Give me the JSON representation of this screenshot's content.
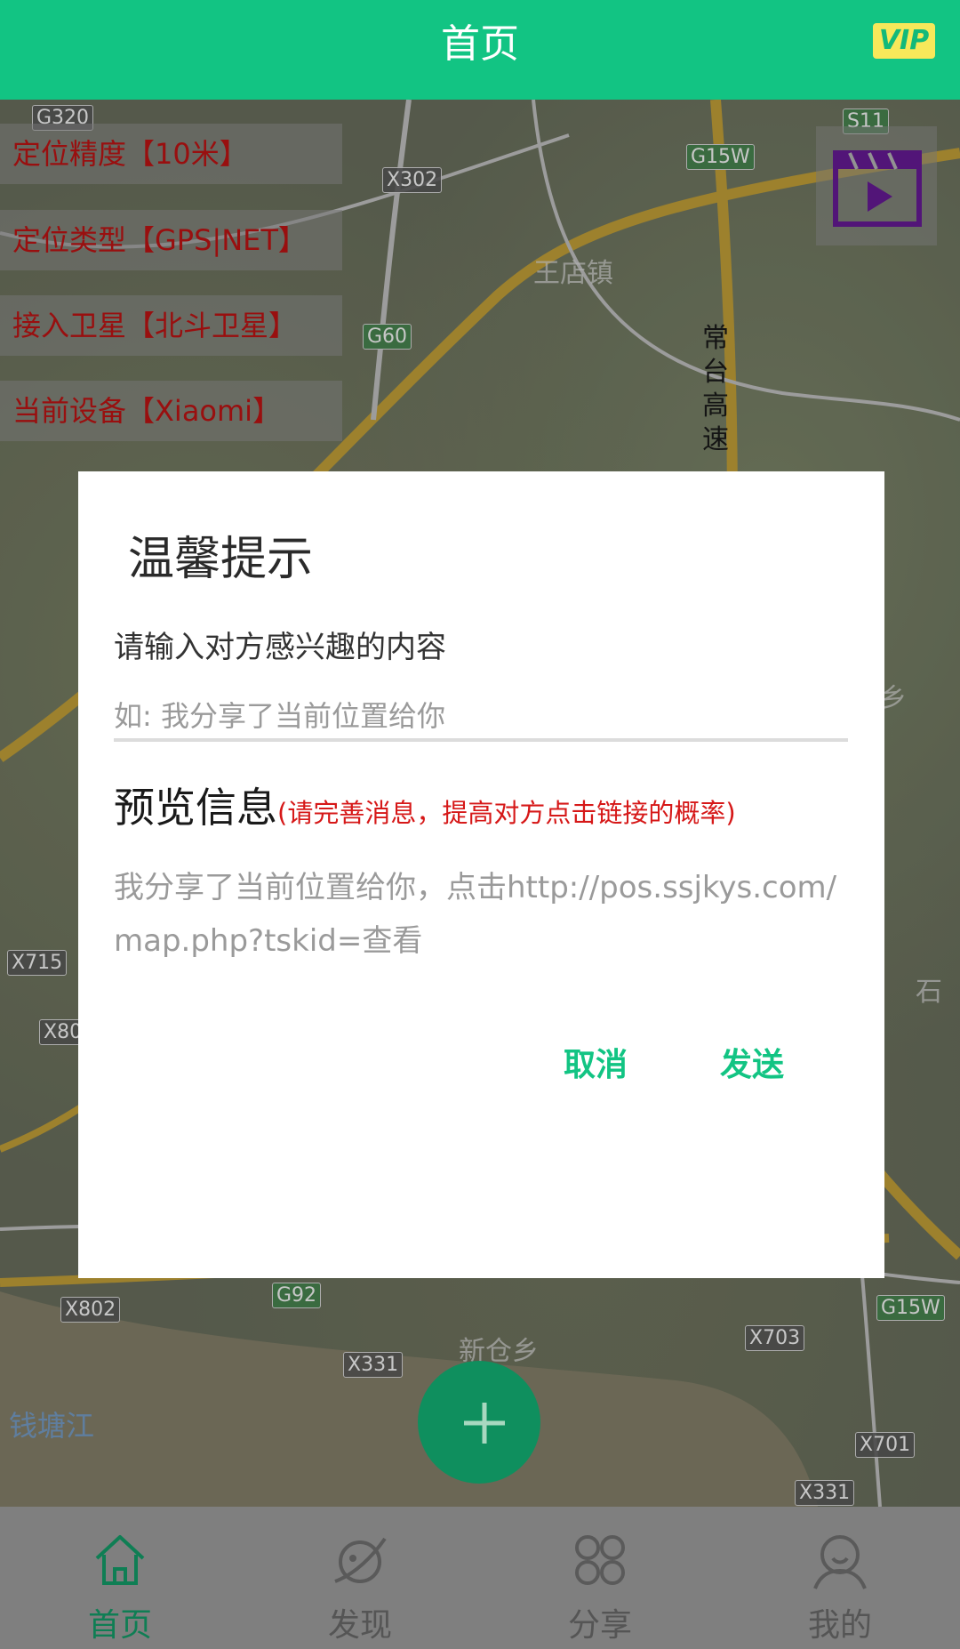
{
  "header": {
    "title": "首页",
    "vip_label": "VIP"
  },
  "info_boxes": [
    {
      "text": "定位精度【10米】"
    },
    {
      "text": "定位类型【GPS|NET】"
    },
    {
      "text": "接入卫星【北斗卫星】"
    },
    {
      "text": "当前设备【Xiaomi】"
    }
  ],
  "map": {
    "road_labels": [
      "G320",
      "X302",
      "G15W",
      "S11",
      "G60",
      "X715",
      "X802",
      "G92",
      "X802",
      "X331",
      "X703",
      "G15W",
      "X701",
      "X331"
    ],
    "places": [
      "王店镇",
      "常台高速",
      "新仓乡",
      "钱塘江",
      "乡",
      "石"
    ]
  },
  "dialog": {
    "title": "温馨提示",
    "label": "请输入对方感兴趣的内容",
    "input_placeholder": "如: 我分享了当前位置给你",
    "input_value": "",
    "preview_title": "预览信息",
    "preview_hint": "(请完善消息，提高对方点击链接的概率)",
    "preview_text": "我分享了当前位置给你，点击http://pos.ssjkys.com/map.php?tskid=查看",
    "cancel_label": "取消",
    "send_label": "发送"
  },
  "nav": [
    {
      "label": "首页",
      "icon": "home-icon",
      "active": true
    },
    {
      "label": "发现",
      "icon": "planet-icon",
      "active": false
    },
    {
      "label": "分享",
      "icon": "grid-icon",
      "active": false
    },
    {
      "label": "我的",
      "icon": "user-icon",
      "active": false
    }
  ],
  "colors": {
    "accent": "#12c483",
    "warning_text": "#c41414",
    "vip_bg": "#f7e85a"
  }
}
